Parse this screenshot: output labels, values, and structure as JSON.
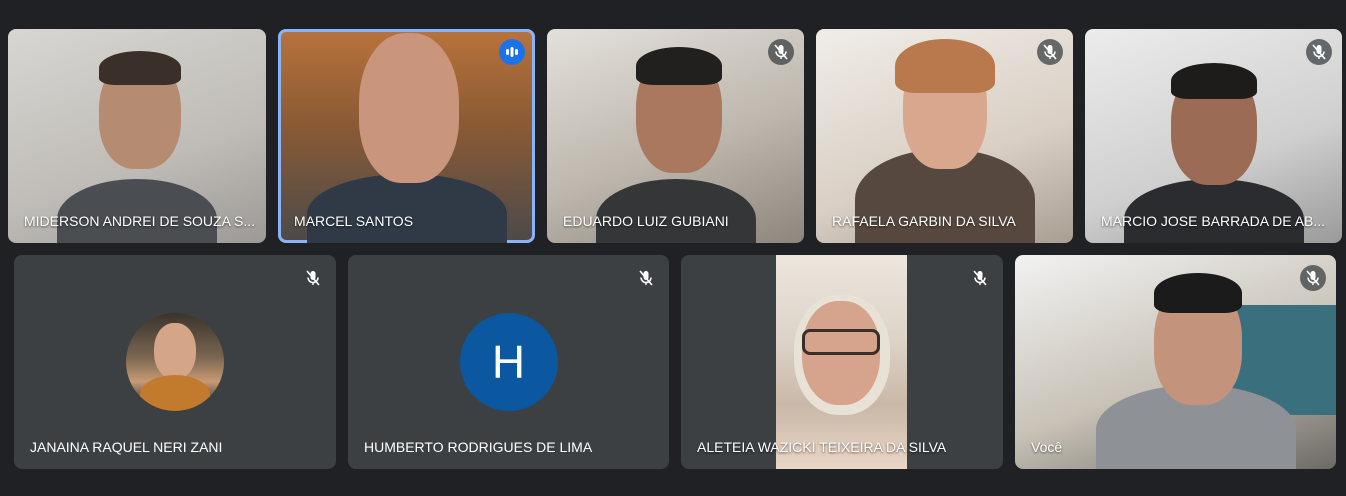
{
  "participants": [
    {
      "name": "MIDERSON ANDREI DE SOUZA S...",
      "mic": "on"
    },
    {
      "name": "MARCEL SANTOS",
      "mic": "speaking"
    },
    {
      "name": "EDUARDO LUIZ GUBIANI",
      "mic": "muted"
    },
    {
      "name": "RAFAELA GARBIN DA SILVA",
      "mic": "muted"
    },
    {
      "name": "MARCIO JOSE BARRADA DE AB...",
      "mic": "muted"
    },
    {
      "name": "JANAINA RAQUEL NERI ZANI",
      "mic": "muted",
      "avatar": "photo"
    },
    {
      "name": "HUMBERTO RODRIGUES DE LIMA",
      "mic": "muted",
      "avatar_letter": "H"
    },
    {
      "name": "ALETEIA WAZICKI TEIXEIRA DA SILVA",
      "mic": "muted"
    },
    {
      "name": "Você",
      "mic": "muted"
    }
  ],
  "colors": {
    "background": "#202124",
    "tile": "#3c4043",
    "speaking_border": "#8ab4f8",
    "speaking_badge": "#1a73e8",
    "avatar_letter_bg": "#0b57a0"
  },
  "icons": {
    "muted": "mic-off-icon",
    "speaking": "audio-level-icon"
  }
}
